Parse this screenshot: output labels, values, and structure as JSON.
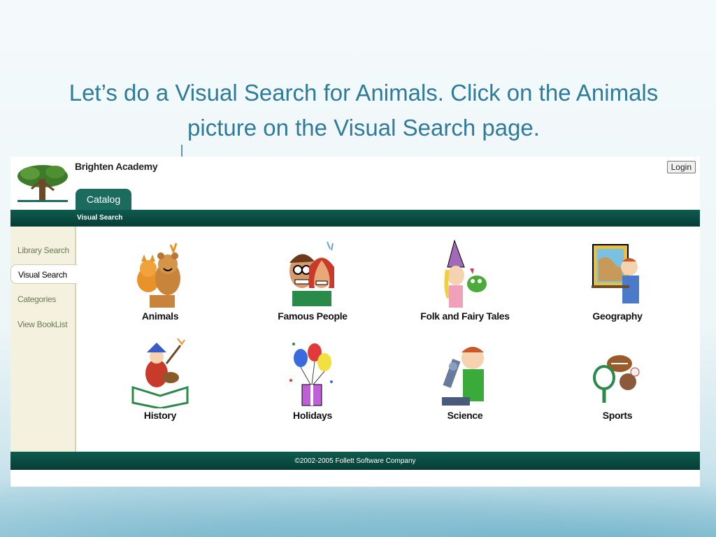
{
  "slide": {
    "instruction": "Let’s do a Visual Search for Animals.  Click on the Animals picture on the Visual Search page."
  },
  "app": {
    "school_name": "Brighten Academy",
    "login_label": "Login",
    "tab_catalog": "Catalog",
    "nav_label": "Visual Search",
    "sidebar": [
      {
        "label": "Library Search",
        "active": false
      },
      {
        "label": "Visual Search",
        "active": true
      },
      {
        "label": "Categories",
        "active": false
      },
      {
        "label": "View BookList",
        "active": false
      }
    ],
    "categories": [
      {
        "label": "Animals",
        "icon": "animals-icon"
      },
      {
        "label": "Famous People",
        "icon": "famous-people-icon"
      },
      {
        "label": "Folk and Fairy Tales",
        "icon": "fairy-tales-icon"
      },
      {
        "label": "Geography",
        "icon": "geography-icon"
      },
      {
        "label": "History",
        "icon": "history-icon"
      },
      {
        "label": "Holidays",
        "icon": "holidays-icon"
      },
      {
        "label": "Science",
        "icon": "science-icon"
      },
      {
        "label": "Sports",
        "icon": "sports-icon"
      }
    ],
    "footer": "©2002-2005  Follett Software Company"
  }
}
